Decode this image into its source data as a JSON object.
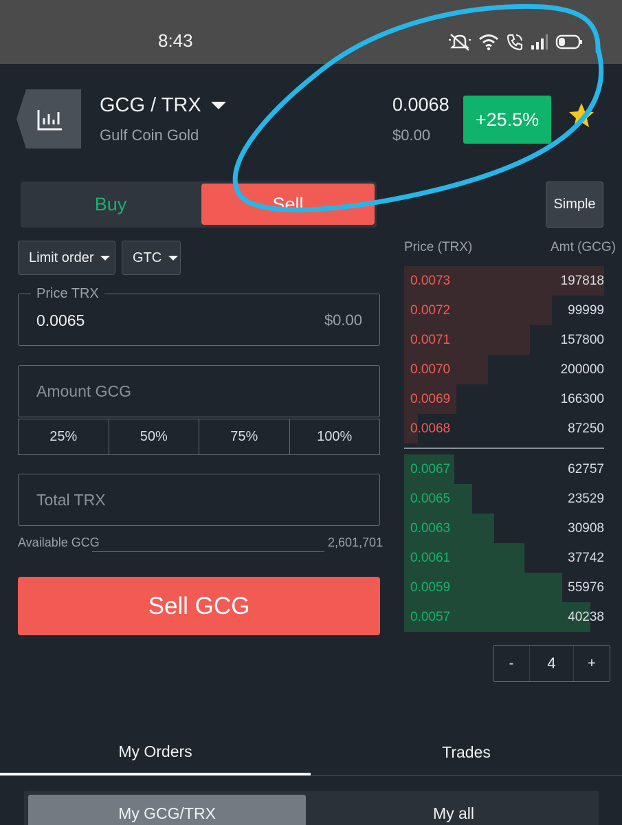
{
  "status_bar": {
    "time": "8:43"
  },
  "header": {
    "pair": "GCG / TRX",
    "coin_name": "Gulf Coin Gold",
    "last_price": "0.0068",
    "usd_price": "$0.00",
    "change": "+25.5%",
    "change_color": "#0fb36b"
  },
  "order_form": {
    "buy_label": "Buy",
    "sell_label": "Sell",
    "simple_label": "Simple",
    "order_type": "Limit order",
    "time_in_force": "GTC",
    "price_label": "Price TRX",
    "price_value": "0.0065",
    "price_usd": "$0.00",
    "amount_placeholder": "Amount GCG",
    "percent_options": [
      "25%",
      "50%",
      "75%",
      "100%"
    ],
    "total_placeholder": "Total TRX",
    "available_label": "Available GCG",
    "available_value": "2,601,701",
    "submit_label": "Sell GCG",
    "buy_color": "#17b26a",
    "sell_color": "#f15b54"
  },
  "order_book": {
    "price_header": "Price (TRX)",
    "amount_header": "Amt (GCG)",
    "asks": [
      {
        "price": "0.0073",
        "amount": "197818",
        "depth": 1.0
      },
      {
        "price": "0.0072",
        "amount": "99999",
        "depth": 0.74
      },
      {
        "price": "0.0071",
        "amount": "157800",
        "depth": 0.63
      },
      {
        "price": "0.0070",
        "amount": "200000",
        "depth": 0.42
      },
      {
        "price": "0.0069",
        "amount": "166300",
        "depth": 0.26
      },
      {
        "price": "0.0068",
        "amount": "87250",
        "depth": 0.07
      }
    ],
    "bids": [
      {
        "price": "0.0067",
        "amount": "62757",
        "depth": 0.25
      },
      {
        "price": "0.0065",
        "amount": "23529",
        "depth": 0.34
      },
      {
        "price": "0.0063",
        "amount": "30908",
        "depth": 0.45
      },
      {
        "price": "0.0061",
        "amount": "37742",
        "depth": 0.6
      },
      {
        "price": "0.0059",
        "amount": "55976",
        "depth": 0.79
      },
      {
        "price": "0.0057",
        "amount": "40238",
        "depth": 0.93
      }
    ],
    "grouping_minus": "-",
    "grouping_value": "4",
    "grouping_plus": "+"
  },
  "bottom_tabs": {
    "my_orders": "My Orders",
    "trades": "Trades",
    "sub_mine": "My GCG/TRX",
    "sub_all": "My all"
  },
  "icons": [
    "chart-icon",
    "caret-down-icon",
    "star-icon",
    "mute-icon",
    "wifi-icon",
    "call-icon",
    "signal-icon",
    "battery-icon"
  ]
}
